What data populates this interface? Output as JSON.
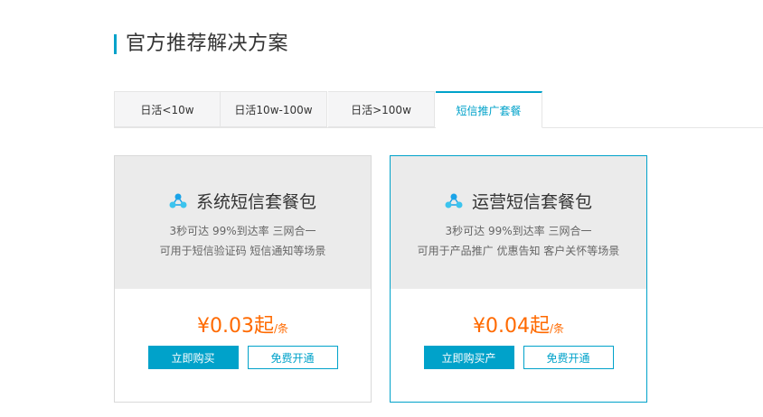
{
  "section": {
    "title": "官方推荐解决方案"
  },
  "tabs": [
    {
      "label": "日活<10w"
    },
    {
      "label": "日活10w-100w"
    },
    {
      "label": "日活>100w"
    },
    {
      "label": "短信推广套餐"
    }
  ],
  "cards": [
    {
      "name": "系统短信套餐包",
      "desc1": "3秒可达 99%到达率 三网合一",
      "desc2": "可用于短信验证码 短信通知等场景",
      "price": "¥0.03起",
      "unit": "/条",
      "buy_label": "立即购买",
      "free_label": "免费开通"
    },
    {
      "name": "运营短信套餐包",
      "desc1": "3秒可达 99%到达率 三网合一",
      "desc2": "可用于产品推广 优惠告知 客户关怀等场景",
      "price": "¥0.04起",
      "unit": "/条",
      "buy_label": "立即购买产",
      "free_label": "免费开通"
    }
  ],
  "colors": {
    "accent": "#00a2ca",
    "price": "#ff6a00",
    "card_top_bg": "#ebebeb"
  },
  "icons": {
    "card_icon": "network-nodes-icon"
  }
}
